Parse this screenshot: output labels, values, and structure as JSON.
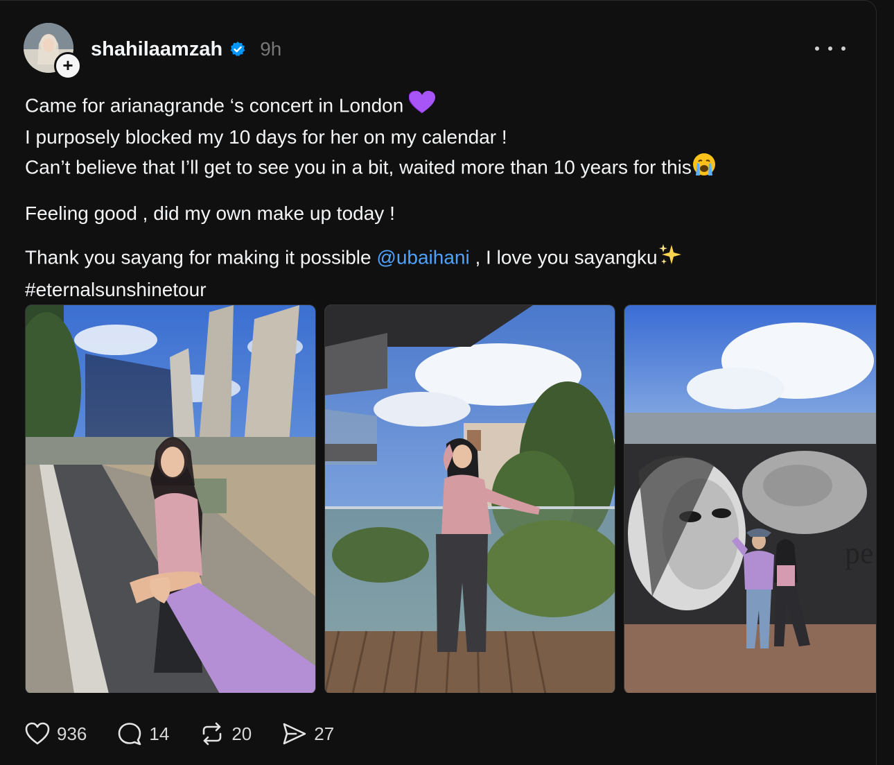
{
  "post": {
    "author": {
      "username": "shahilaamzah",
      "verified": true,
      "time_ago": "9h",
      "follow_symbol": "+"
    },
    "text": {
      "line1": "Came for arianagrande ‘s concert in London",
      "line1_emoji": "purple-heart",
      "line2": "I purposely blocked my 10 days for her on my calendar !",
      "line3": "Can’t believe that I’ll get to see you in a bit, waited more than 10 years for this",
      "line3_emoji": "loudly-crying-face",
      "line4": "Feeling good , did my own make up today !",
      "line5_before": "Thank you sayang for making it possible ",
      "line5_mention": "@ubaihani",
      "line5_after": " , I love you sayangku",
      "line5_emoji": "sparkles",
      "line6": "#eternalsunshinetour"
    },
    "media": [
      {
        "name": "photo-street-towers",
        "subject": "woman in pink top and black headscarf holding hand on a path with tall buildings"
      },
      {
        "name": "photo-balcony",
        "subject": "woman in pink top and black headscarf posing on a balcony with trees"
      },
      {
        "name": "photo-mural",
        "subject": "couple posing in front of black and white mural"
      }
    ],
    "mural_text": "pe",
    "stats": {
      "likes": "936",
      "replies": "14",
      "reposts": "20",
      "shares": "27"
    }
  },
  "colors": {
    "background": "#101010",
    "text": "#f3f5f7",
    "muted": "#777777",
    "mention": "#4da3ff",
    "verified": "#0095f6"
  }
}
